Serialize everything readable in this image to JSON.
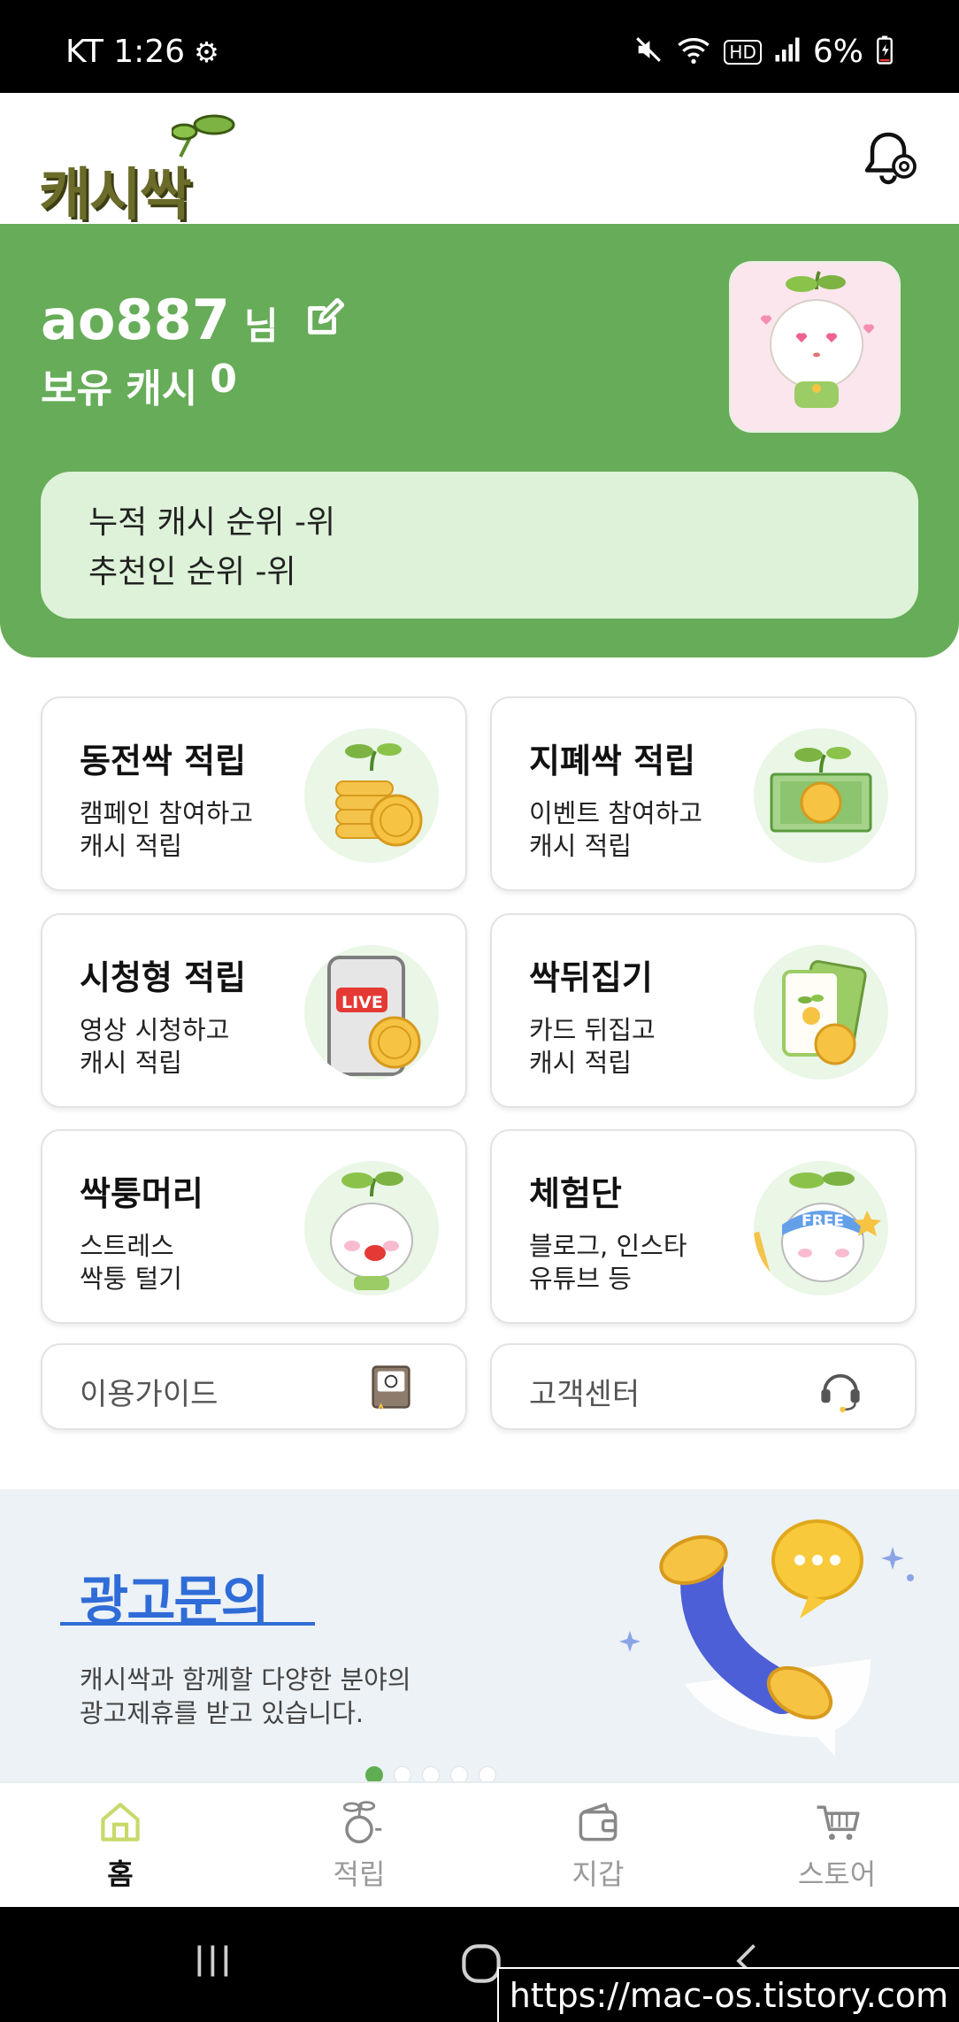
{
  "status_bar": {
    "carrier_time": "KT 1:26",
    "battery": "6%",
    "hd_label": "HD"
  },
  "app": {
    "logo_text": "캐시싹"
  },
  "profile": {
    "username": "ao887",
    "honorific": "님",
    "cash_label": "보유 캐시",
    "cash_value": "0",
    "rank_cumulative": "누적 캐시 순위 -위",
    "rank_referral": "추천인 순위 -위"
  },
  "menu": [
    {
      "title": "동전싹 적립",
      "line1": "캠페인 참여하고",
      "line2": "캐시 적립"
    },
    {
      "title": "지폐싹 적립",
      "line1": "이벤트 참여하고",
      "line2": "캐시 적립"
    },
    {
      "title": "시청형 적립",
      "line1": "영상 시청하고",
      "line2": "캐시 적립"
    },
    {
      "title": "싹뒤집기",
      "line1": "카드 뒤집고",
      "line2": "캐시 적립"
    },
    {
      "title": "싹퉁머리",
      "line1": "스트레스",
      "line2": "싹퉁 털기"
    },
    {
      "title": "체험단",
      "line1": "블로그, 인스타",
      "line2": "유튜브 등"
    }
  ],
  "shortcuts": {
    "guide": "이용가이드",
    "support": "고객센터"
  },
  "art_labels": {
    "live": "LIVE",
    "free": "FREE"
  },
  "banner": {
    "title": "광고문의",
    "desc_line1": "캐시싹과 함께할 다양한 분야의",
    "desc_line2": "광고제휴를 받고 있습니다.",
    "page_count": 5,
    "active_page": 1
  },
  "bottom_nav": {
    "home": "홈",
    "earn": "적립",
    "wallet": "지갑",
    "store": "스토어",
    "active": "home"
  },
  "watermark": "https://mac-os.tistory.com",
  "colors": {
    "brand_green": "#67ac59",
    "rank_bg": "#ddf2d8",
    "banner_blue": "#2f6cd8"
  }
}
